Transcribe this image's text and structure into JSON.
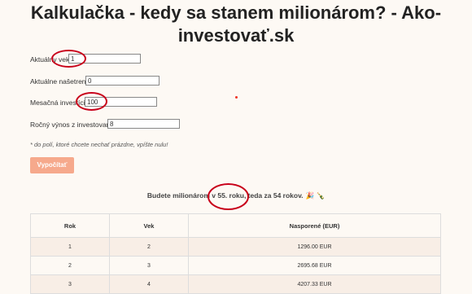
{
  "title_line1": "Kalkulačka - kedy sa stanem milionárom? - Ako-",
  "title_line2": "investovať.sk",
  "form": {
    "age_label": "Aktuálny vek:",
    "age_value": "1",
    "savings_label": "Aktuálne našetrené:",
    "savings_value": "0",
    "monthly_label": "Mesačná investícia:",
    "monthly_value": "100",
    "yield_label": "Ročný výnos z investovania:",
    "yield_value": "8",
    "note": "* do polí, ktoré chcete nechať prázdne, vpíšte nulu!",
    "calculate_button": "Vypočítať"
  },
  "result": {
    "text": "Budete milionárom v 55. roku, teda za 54 rokov.",
    "emojis": "🎉 🍾"
  },
  "table": {
    "headers": [
      "Rok",
      "Vek",
      "Nasporené (EUR)"
    ],
    "rows": [
      [
        "1",
        "2",
        "1296.00 EUR"
      ],
      [
        "2",
        "3",
        "2695.68 EUR"
      ],
      [
        "3",
        "4",
        "4207.33 EUR"
      ]
    ]
  },
  "colors": {
    "annotation_circle": "#c8001a",
    "button": "#f6a98c",
    "row_highlight": "#f8eee6"
  }
}
